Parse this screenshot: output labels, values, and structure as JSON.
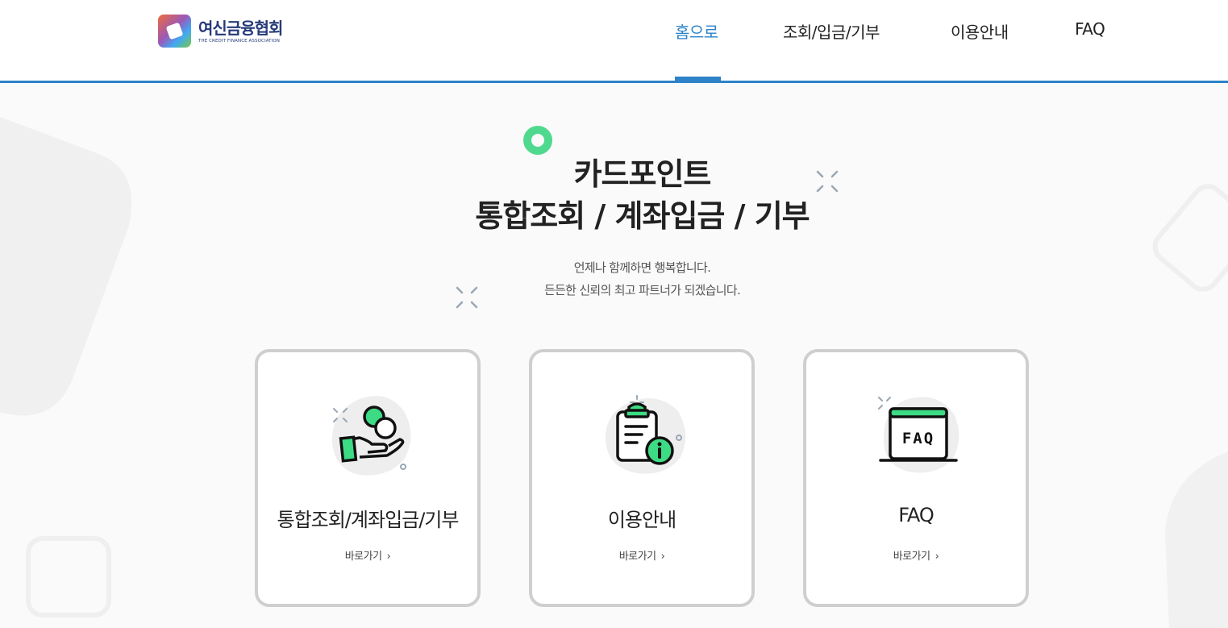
{
  "header": {
    "logo": {
      "name_ko": "여신금융협회",
      "name_en": "THE CREDIT FINANCE ASSOCIATION"
    },
    "nav": [
      {
        "label": "홈으로",
        "active": true
      },
      {
        "label": "조회/입금/기부",
        "active": false
      },
      {
        "label": "이용안내",
        "active": false
      },
      {
        "label": "FAQ",
        "active": false
      }
    ]
  },
  "hero": {
    "title_line1": "카드포인트",
    "title_line2": "통합조회 / 계좌입금 / 기부",
    "subtitle_line1": "언제나 함께하면 행복합니다.",
    "subtitle_line2": "든든한 신뢰의 최고 파트너가 되겠습니다."
  },
  "cards": [
    {
      "title": "통합조회/계좌입금/기부",
      "link": "바로가기",
      "icon": "hand-coins-icon"
    },
    {
      "title": "이용안내",
      "link": "바로가기",
      "icon": "clipboard-info-icon"
    },
    {
      "title": "FAQ",
      "link": "바로가기",
      "icon": "faq-window-icon"
    }
  ],
  "colors": {
    "accent": "#2d82c8",
    "green": "#3ddc84",
    "card_border": "#cfcfcf",
    "brand_navy": "#263a7a"
  }
}
